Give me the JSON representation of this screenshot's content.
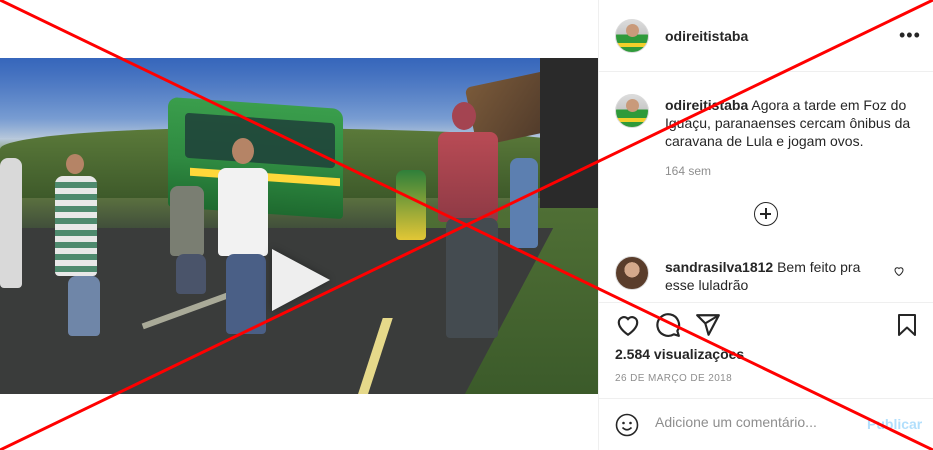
{
  "post": {
    "username": "odireitistaba",
    "more_label": "•••"
  },
  "caption": {
    "username": "odireitistaba",
    "text": "Agora a tarde em Foz do Iguaçu, paranaenses cercam ônibus da caravana de Lula e jogam ovos.",
    "time_ago": "164 sem"
  },
  "comments": [
    {
      "username": "sandrasilva1812",
      "text": "Bem feito pra esse luladrão"
    }
  ],
  "stats": {
    "views": "2.584 visualizações",
    "date": "26 DE MARÇO DE 2018"
  },
  "comment_box": {
    "placeholder": "Adicione um comentário...",
    "publish_label": "Publicar"
  },
  "icons": {
    "more": "more-options-icon",
    "load_more": "plus-circle-icon",
    "like": "heart-icon",
    "comment": "comment-bubble-icon",
    "share": "paper-plane-icon",
    "save": "bookmark-icon",
    "emoji": "smiley-icon",
    "mute": "speaker-muted-icon",
    "play": "play-icon"
  },
  "colors": {
    "overlay_cross": "#ff0000",
    "publish_disabled": "#b2dffc",
    "secondary_text": "#8e8e8e"
  }
}
